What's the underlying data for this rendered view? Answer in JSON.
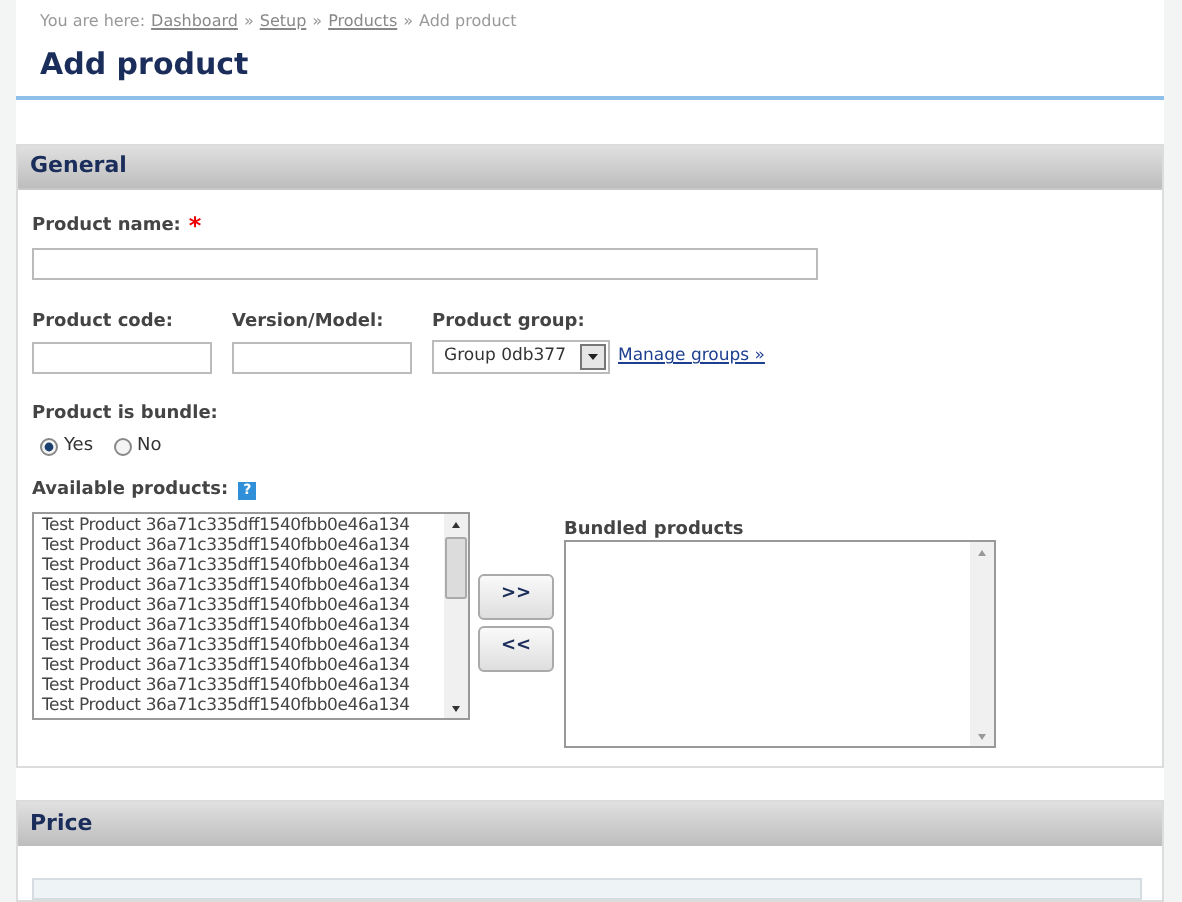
{
  "breadcrumb": {
    "prefix": "You are here:",
    "links": [
      "Dashboard",
      "Setup",
      "Products"
    ],
    "separator": "»",
    "current": "Add product"
  },
  "title": "Add product",
  "sections": [
    {
      "title": "General"
    },
    {
      "title": "Price"
    }
  ],
  "product_name": {
    "label": "Product name:",
    "required_mark": "*"
  },
  "product_code": {
    "label": "Product code:"
  },
  "version_model": {
    "label": "Version/Model:"
  },
  "product_group": {
    "label": "Product group:",
    "value": "Group 0db377",
    "link": "Manage groups »"
  },
  "bundle": {
    "label": "Product is bundle:",
    "options": [
      {
        "label": "Yes",
        "selected": true
      },
      {
        "label": "No",
        "selected": false
      }
    ]
  },
  "available": {
    "label": "Available products:",
    "help": "?",
    "items": [
      "Test Product 36a71c335dff1540fbb0e46a134",
      "Test Product 36a71c335dff1540fbb0e46a134",
      "Test Product 36a71c335dff1540fbb0e46a134",
      "Test Product 36a71c335dff1540fbb0e46a134",
      "Test Product 36a71c335dff1540fbb0e46a134",
      "Test Product 36a71c335dff1540fbb0e46a134",
      "Test Product 36a71c335dff1540fbb0e46a134",
      "Test Product 36a71c335dff1540fbb0e46a134",
      "Test Product 36a71c335dff1540fbb0e46a134",
      "Test Product 36a71c335dff1540fbb0e46a134"
    ]
  },
  "move_buttons": [
    ">>",
    "<<"
  ],
  "bundled": {
    "label": "Bundled products"
  }
}
